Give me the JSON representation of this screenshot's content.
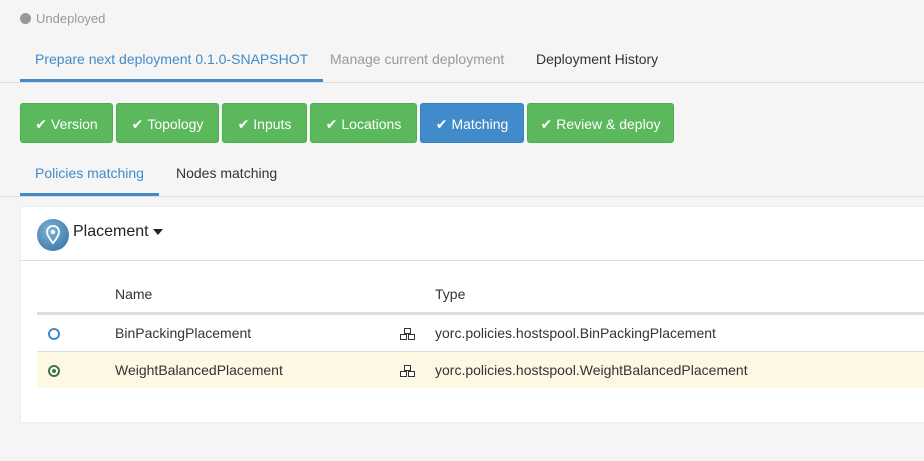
{
  "status": {
    "label": "Undeployed"
  },
  "top_tabs": [
    {
      "label": "Prepare next deployment 0.1.0-SNAPSHOT"
    },
    {
      "label": "Manage current deployment"
    },
    {
      "label": "Deployment History"
    }
  ],
  "steps": [
    {
      "label": "Version"
    },
    {
      "label": "Topology"
    },
    {
      "label": "Inputs"
    },
    {
      "label": "Locations"
    },
    {
      "label": "Matching"
    },
    {
      "label": "Review & deploy"
    }
  ],
  "sub_tabs": [
    {
      "label": "Policies matching"
    },
    {
      "label": "Nodes matching"
    }
  ],
  "policy": {
    "title": "Placement",
    "columns": {
      "name": "Name",
      "type": "Type"
    },
    "rows": [
      {
        "name": "BinPackingPlacement",
        "type": "yorc.policies.hostspool.BinPackingPlacement",
        "selected": false
      },
      {
        "name": "WeightBalancedPlacement",
        "type": "yorc.policies.hostspool.WeightBalancedPlacement",
        "selected": true
      }
    ]
  },
  "colors": {
    "success": "#5cb85c",
    "primary": "#428bca",
    "selected_row": "#fcf8e3"
  }
}
